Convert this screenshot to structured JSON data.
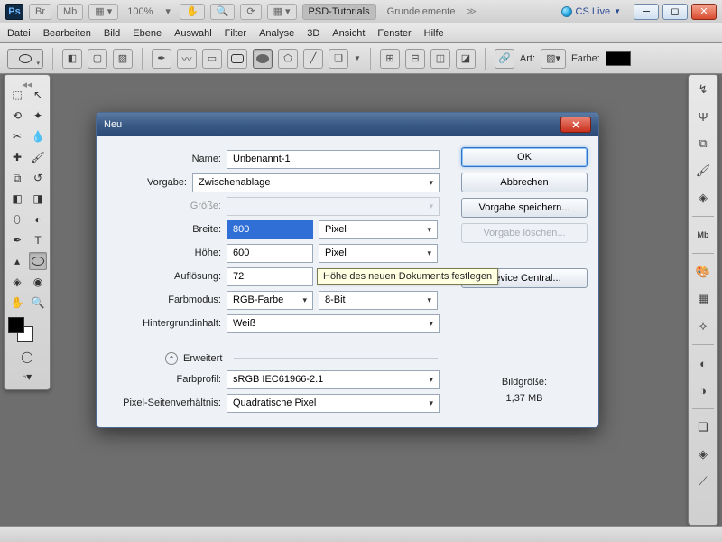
{
  "appbar": {
    "logo": "Ps",
    "zoom": "100%",
    "workspace1": "PSD-Tutorials",
    "workspace2": "Grundelemente",
    "cslive": "CS Live"
  },
  "menu": {
    "datei": "Datei",
    "bearbeiten": "Bearbeiten",
    "bild": "Bild",
    "ebene": "Ebene",
    "auswahl": "Auswahl",
    "filter": "Filter",
    "analyse": "Analyse",
    "d3d": "3D",
    "ansicht": "Ansicht",
    "fenster": "Fenster",
    "hilfe": "Hilfe"
  },
  "optbar": {
    "art": "Art:",
    "farbe": "Farbe:"
  },
  "dialog": {
    "title": "Neu",
    "labels": {
      "name": "Name:",
      "vorgabe": "Vorgabe:",
      "groesse": "Größe:",
      "breite": "Breite:",
      "hoehe": "Höhe:",
      "aufloesung": "Auflösung:",
      "farbmodus": "Farbmodus:",
      "hintergrund": "Hintergrundinhalt:",
      "erweitert": "Erweitert",
      "farbprofil": "Farbprofil:",
      "pixelsv": "Pixel-Seitenverhältnis:"
    },
    "values": {
      "name": "Unbenannt-1",
      "vorgabe": "Zwischenablage",
      "breite": "800",
      "breite_unit": "Pixel",
      "hoehe": "600",
      "hoehe_unit": "Pixel",
      "aufloesung": "72",
      "farbmodus": "RGB-Farbe",
      "farbtiefe": "8-Bit",
      "hintergrund": "Weiß",
      "farbprofil": "sRGB IEC61966-2.1",
      "pixelsv": "Quadratische Pixel"
    },
    "buttons": {
      "ok": "OK",
      "abbrechen": "Abbrechen",
      "speichern": "Vorgabe speichern...",
      "loeschen": "Vorgabe löschen...",
      "device": "Device Central..."
    },
    "size_title": "Bildgröße:",
    "size_value": "1,37 MB",
    "tooltip": "Höhe des neuen Dokuments festlegen"
  }
}
